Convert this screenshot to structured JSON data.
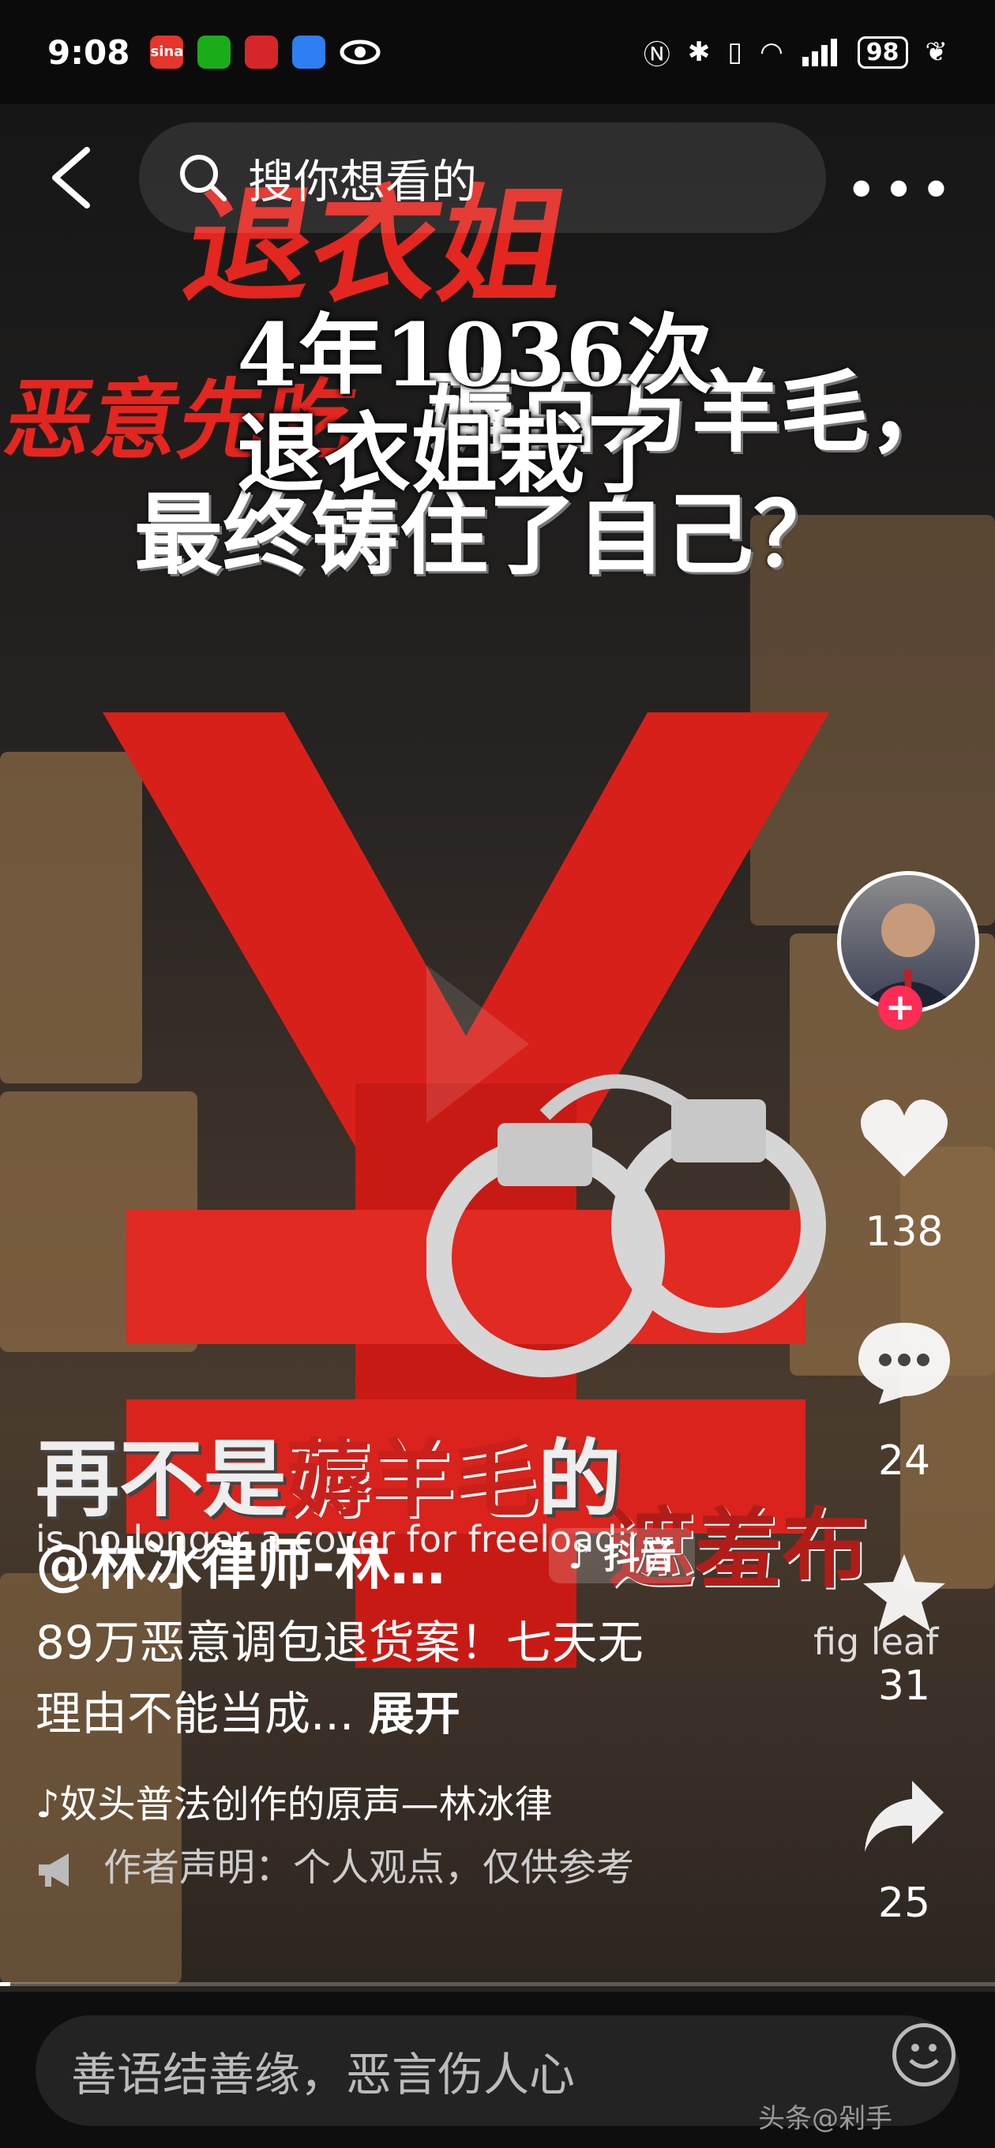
{
  "status_bar": {
    "time": "9:08",
    "battery": "98",
    "sina_label": "sina"
  },
  "search": {
    "placeholder": "搜你想看的"
  },
  "video": {
    "overlay_title_line1": "4年1036次",
    "overlay_title_line2": "退衣姐栽了",
    "headline_line1": "薅百万羊毛，",
    "headline_line2": "最终铸住了自己？",
    "subtitle_cn_part1": "再不是",
    "subtitle_cn_part2": "薅羊毛",
    "subtitle_cn_part3": "的",
    "subtitle_en": "is no longer a cover for freeloading",
    "fig_leaf_cn": "遮羞布",
    "fig_leaf_en": "fig leaf",
    "bg_red_top": "退衣姐",
    "bg_red_left": "恶意先吃"
  },
  "side_actions": {
    "likes": "138",
    "comments": "24",
    "favorites": "31",
    "shares": "25"
  },
  "info": {
    "author": "@林冰律师-林…",
    "badge": "抖音",
    "desc": "89万恶意调包退货案！七天无理由不能当成...",
    "expand": "展开",
    "music": "奴头普法创作的原声—林冰律",
    "declaration": "作者声明：个人观点，仅供参考"
  },
  "progress": {
    "fraction": 0.01
  },
  "bottom": {
    "comment_placeholder": "善语结善缘，恶言伤人心",
    "watermark": "头条@剁手"
  },
  "colors": {
    "accent_red": "#e3261f",
    "follow_pink": "#fe2c55"
  }
}
